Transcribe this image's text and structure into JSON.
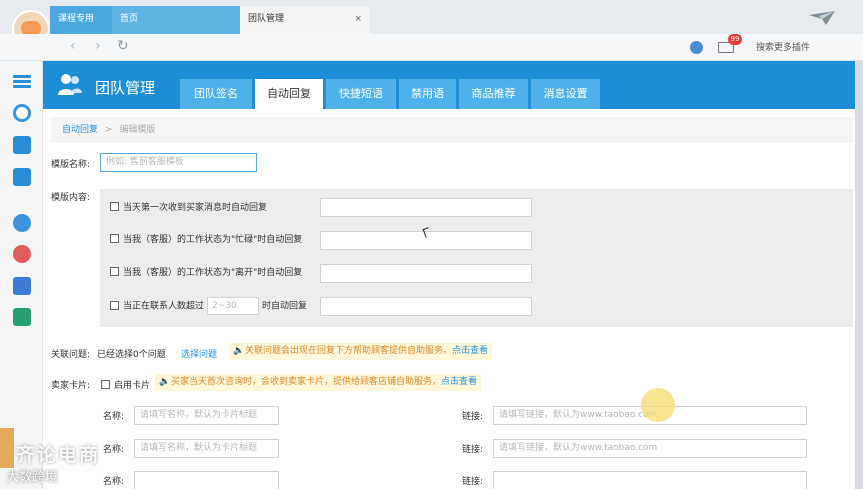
{
  "titlebar": {
    "tabs": [
      {
        "label": "课程专用"
      },
      {
        "label": "首页"
      },
      {
        "label": "团队管理",
        "close": "×"
      }
    ]
  },
  "navbar": {
    "back": "‹",
    "forward": "›",
    "refresh": "↻",
    "mail_badge": "99",
    "plugin_link": "搜索更多插件"
  },
  "header": {
    "title": "团队管理",
    "tabs": [
      {
        "label": "团队签名",
        "active": false
      },
      {
        "label": "自动回复",
        "active": true
      },
      {
        "label": "快捷短语",
        "active": false
      },
      {
        "label": "禁用语",
        "active": false
      },
      {
        "label": "商品推荐",
        "active": false
      },
      {
        "label": "消息设置",
        "active": false
      }
    ]
  },
  "breadcrumb": {
    "root": "自动回复",
    "sep": ">",
    "current": "编辑模版"
  },
  "form": {
    "template_name_label": "模版名称:",
    "template_name_placeholder": "例如: 售前客服模板",
    "template_content_label": "模版内容:",
    "rules": [
      {
        "label": "当天第一次收到买家消息时自动回复"
      },
      {
        "label": "当我（客服）的工作状态为\"忙碌\"时自动回复"
      },
      {
        "label": "当我（客服）的工作状态为\"离开\"时自动回复"
      }
    ],
    "contact_rule": {
      "prefix": "当正在联系人数超过",
      "range_placeholder": "2~30",
      "suffix": "时自动回复"
    },
    "related": {
      "label": "关联问题:",
      "value": "已经选择0个问题",
      "select_link": "选择问题",
      "notice": "关联问题会出现在回复下方帮助顾客提供自助服务。",
      "notice_link": "点击查看"
    },
    "seller_card": {
      "label": "卖家卡片:",
      "enable_label": "启用卡片",
      "notice": "买家当天首次咨询时，会收到卖家卡片，提供给顾客店铺自助服务，",
      "notice_link": "点击查看"
    },
    "card_rows": [
      {
        "name_label": "名称:",
        "name_placeholder": "请填写名称，默认为卡片标题",
        "link_label": "链接:",
        "link_placeholder": "请填写链接，默认为www.taobao.com"
      },
      {
        "name_label": "名称:",
        "name_placeholder": "请填写名称，默认为卡片标题",
        "link_label": "链接:",
        "link_placeholder": "请填写链接，默认为www.taobao.com"
      },
      {
        "name_label": "名称:",
        "name_placeholder": "",
        "link_label": "链接:",
        "link_placeholder": ""
      }
    ]
  },
  "watermark": {
    "line1": "齐论电商",
    "line2": "大数跨境"
  },
  "colors": {
    "accent": "#1e8fd7",
    "tab_inactive": "#4eb1ea",
    "link": "#2b8fd8",
    "notice_bg": "#fff7d9",
    "notice_text": "#d8892b"
  }
}
